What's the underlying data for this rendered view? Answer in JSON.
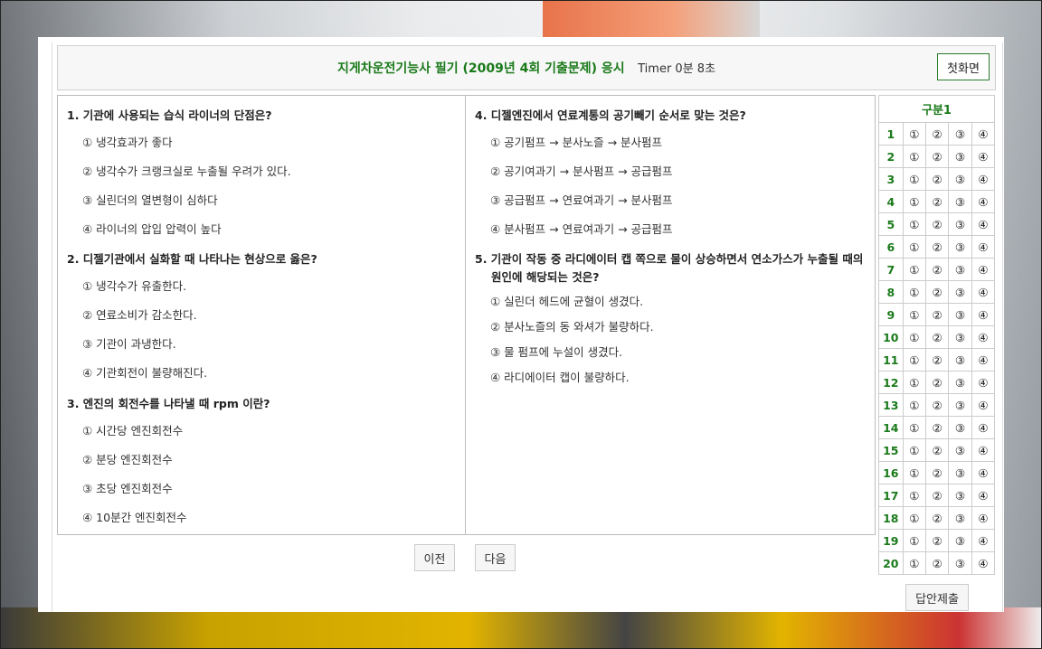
{
  "header": {
    "title": "지게차운전기능사 필기 (2009년 4회 기출문제) 응시",
    "timer": "Timer 0분 8초",
    "home_label": "첫화면"
  },
  "questions": [
    {
      "title": "1.  기관에 사용되는 습식 라이너의 단점은?",
      "options": [
        "① 냉각효과가 좋다",
        "② 냉각수가 크랭크실로 누출될 우려가 있다.",
        "③ 실린더의 열변형이 심하다",
        "④ 라이너의 압입 압력이 높다"
      ]
    },
    {
      "title": "2.  디젤기관에서 실화할 때 나타나는 현상으로 옳은?",
      "options": [
        "① 냉각수가 유출한다.",
        "② 연료소비가 감소한다.",
        "③ 기관이 과냉한다.",
        "④ 기관회전이 불량해진다."
      ]
    },
    {
      "title": "3.  엔진의 회전수를 나타낼 때 rpm 이란?",
      "options": [
        "① 시간당 엔진회전수",
        "② 분당 엔진회전수",
        "③ 초당 엔진회전수",
        "④ 10분간 엔진회전수"
      ]
    },
    {
      "title": "4.  디젤엔진에서 연료계통의 공기빼기 순서로 맞는 것은?",
      "options": [
        "① 공기펌프 → 분사노즐 → 분사펌프",
        "② 공기여과기 → 분사펌프 → 공급펌프",
        "③ 공급펌프 → 연료여과기 → 분사펌프",
        "④ 분사펌프 → 연료여과기 → 공급펌프"
      ]
    },
    {
      "title": "5.  기관이 작동 중 라디에이터 캡 쪽으로 물이 상승하면서 연소가스가 누출될 때의 원인에 해당되는 것은?",
      "options": [
        "① 실린더 헤드에 균혈이 생겼다.",
        "② 분사노즐의 동 와셔가 불량하다.",
        "③ 물 펌프에 누설이 생겼다.",
        "④ 라디에이터 캡이 불량하다."
      ]
    }
  ],
  "nav": {
    "prev_label": "이전",
    "next_label": "다음"
  },
  "answer_sheet": {
    "header": "구분1",
    "choices": [
      "①",
      "②",
      "③",
      "④"
    ],
    "numbers": [
      "1",
      "2",
      "3",
      "4",
      "5",
      "6",
      "7",
      "8",
      "9",
      "10",
      "11",
      "12",
      "13",
      "14",
      "15",
      "16",
      "17",
      "18",
      "19",
      "20"
    ]
  },
  "submit_label": "답안제출",
  "colors": {
    "accent_green": "#1a7a1a"
  }
}
